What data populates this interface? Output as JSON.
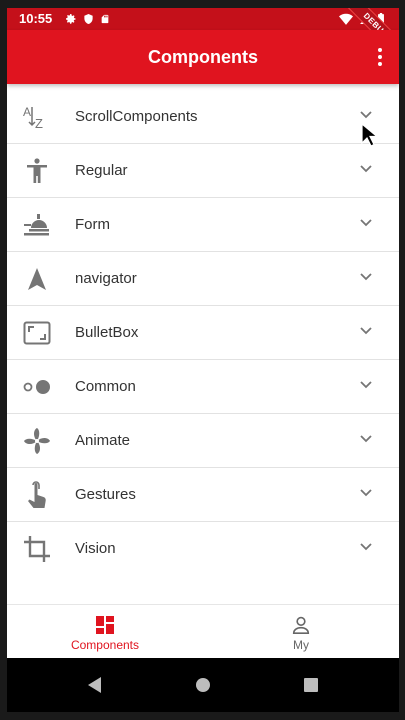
{
  "status_bar": {
    "time": "10:55",
    "debug_label": "DEBUG"
  },
  "app_bar": {
    "title": "Components",
    "menu_icon": "more-vert-icon"
  },
  "list": {
    "items": [
      {
        "label": "ScrollComponents",
        "icon": "sort-az-icon"
      },
      {
        "label": "Regular",
        "icon": "accessibility-icon"
      },
      {
        "label": "Form",
        "icon": "room-service-icon"
      },
      {
        "label": "navigator",
        "icon": "navigation-icon"
      },
      {
        "label": "BulletBox",
        "icon": "aspect-ratio-icon"
      },
      {
        "label": "Common",
        "icon": "toggle-dots-icon"
      },
      {
        "label": "Animate",
        "icon": "pinwheel-icon"
      },
      {
        "label": "Gestures",
        "icon": "touch-app-icon"
      },
      {
        "label": "Vision",
        "icon": "crop-icon"
      }
    ]
  },
  "bottom_nav": {
    "items": [
      {
        "label": "Components",
        "icon": "dashboard-icon",
        "active": true
      },
      {
        "label": "My",
        "icon": "person-icon",
        "active": false
      }
    ]
  },
  "colors": {
    "primary": "#e0141f",
    "status_bar": "#c4101a",
    "icon_grey": "#757575"
  }
}
